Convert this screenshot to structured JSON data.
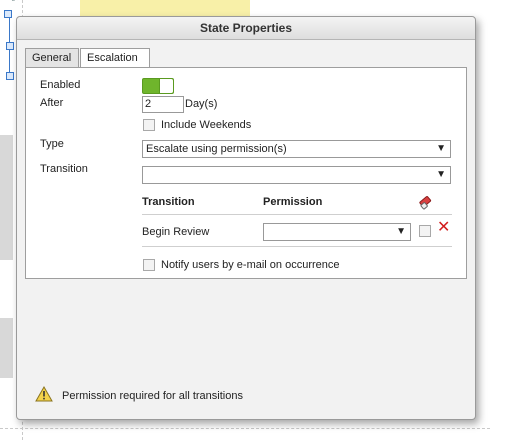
{
  "dialog": {
    "title": "State Properties"
  },
  "tabs": [
    {
      "label": "General"
    },
    {
      "label": "Escalation"
    }
  ],
  "escalation": {
    "enabled_label": "Enabled",
    "enabled": true,
    "after_label": "After",
    "after_value": "2",
    "after_unit": "Day(s)",
    "include_weekends_label": "Include Weekends",
    "type_label": "Type",
    "type_value": "Escalate using permission(s)",
    "transition_label": "Transition",
    "transition_value": "",
    "table": {
      "headers": [
        "Transition",
        "Permission"
      ],
      "rows": [
        {
          "transition": "Begin Review",
          "permission": ""
        }
      ]
    },
    "notify_label": "Notify users by e-mail on occurrence"
  },
  "footer": {
    "warning": "Permission required for all transitions"
  },
  "colors": {
    "toggle_on": "#6fb52c",
    "delete": "#d21d1d",
    "warning": "#f3d24a"
  },
  "icons": {
    "clear": "eraser-icon",
    "delete": "close-icon",
    "warning": "warning-icon",
    "dropdown": "triangle-down"
  }
}
